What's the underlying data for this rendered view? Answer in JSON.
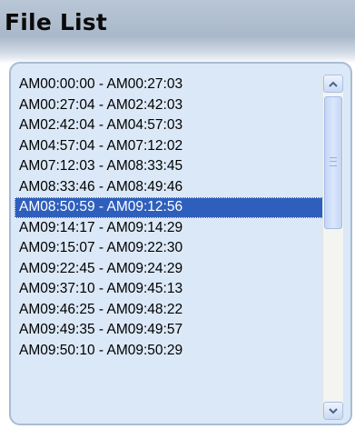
{
  "panel": {
    "title": "File List"
  },
  "files": [
    "AM00:00:00 - AM00:27:03",
    "AM00:27:04 - AM02:42:03",
    "AM02:42:04 - AM04:57:03",
    "AM04:57:04 - AM07:12:02",
    "AM07:12:03 - AM08:33:45",
    "AM08:33:46 - AM08:49:46",
    "AM08:50:59 - AM09:12:56",
    "AM09:14:17 - AM09:14:29",
    "AM09:15:07 - AM09:22:30",
    "AM09:22:45 - AM09:24:29",
    "AM09:37:10 - AM09:45:13",
    "AM09:46:25 - AM09:48:22",
    "AM09:49:35 - AM09:49:57",
    "AM09:50:10 - AM09:50:29"
  ],
  "selected_index": 6,
  "scrollbar": {
    "up_icon": "chevron-up-icon",
    "down_icon": "chevron-down-icon",
    "thumb_position_fraction": 0.0
  },
  "colors": {
    "selection": "#2f5fbd",
    "list_background": "#dbe8f7",
    "panel_header": "#b9c6d6"
  }
}
